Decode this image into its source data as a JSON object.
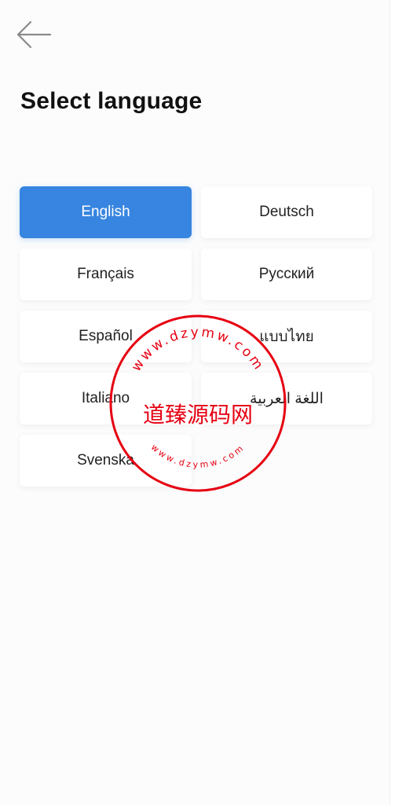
{
  "header": {
    "title": "Select language"
  },
  "languages": [
    {
      "label": "English",
      "selected": true
    },
    {
      "label": "Deutsch",
      "selected": false
    },
    {
      "label": "Français",
      "selected": false
    },
    {
      "label": "Русский",
      "selected": false
    },
    {
      "label": "Español",
      "selected": false
    },
    {
      "label": "แบบไทย",
      "selected": false
    },
    {
      "label": "Italiano",
      "selected": false
    },
    {
      "label": "اللغة العربية",
      "selected": false
    },
    {
      "label": "Svenska",
      "selected": false
    }
  ],
  "watermark": {
    "center_text": "道臻源码网",
    "ring_text": "www.dzymw.com",
    "color": "#e60012"
  },
  "colors": {
    "accent": "#3785e0",
    "title": "#111111",
    "button_text": "#222222"
  }
}
